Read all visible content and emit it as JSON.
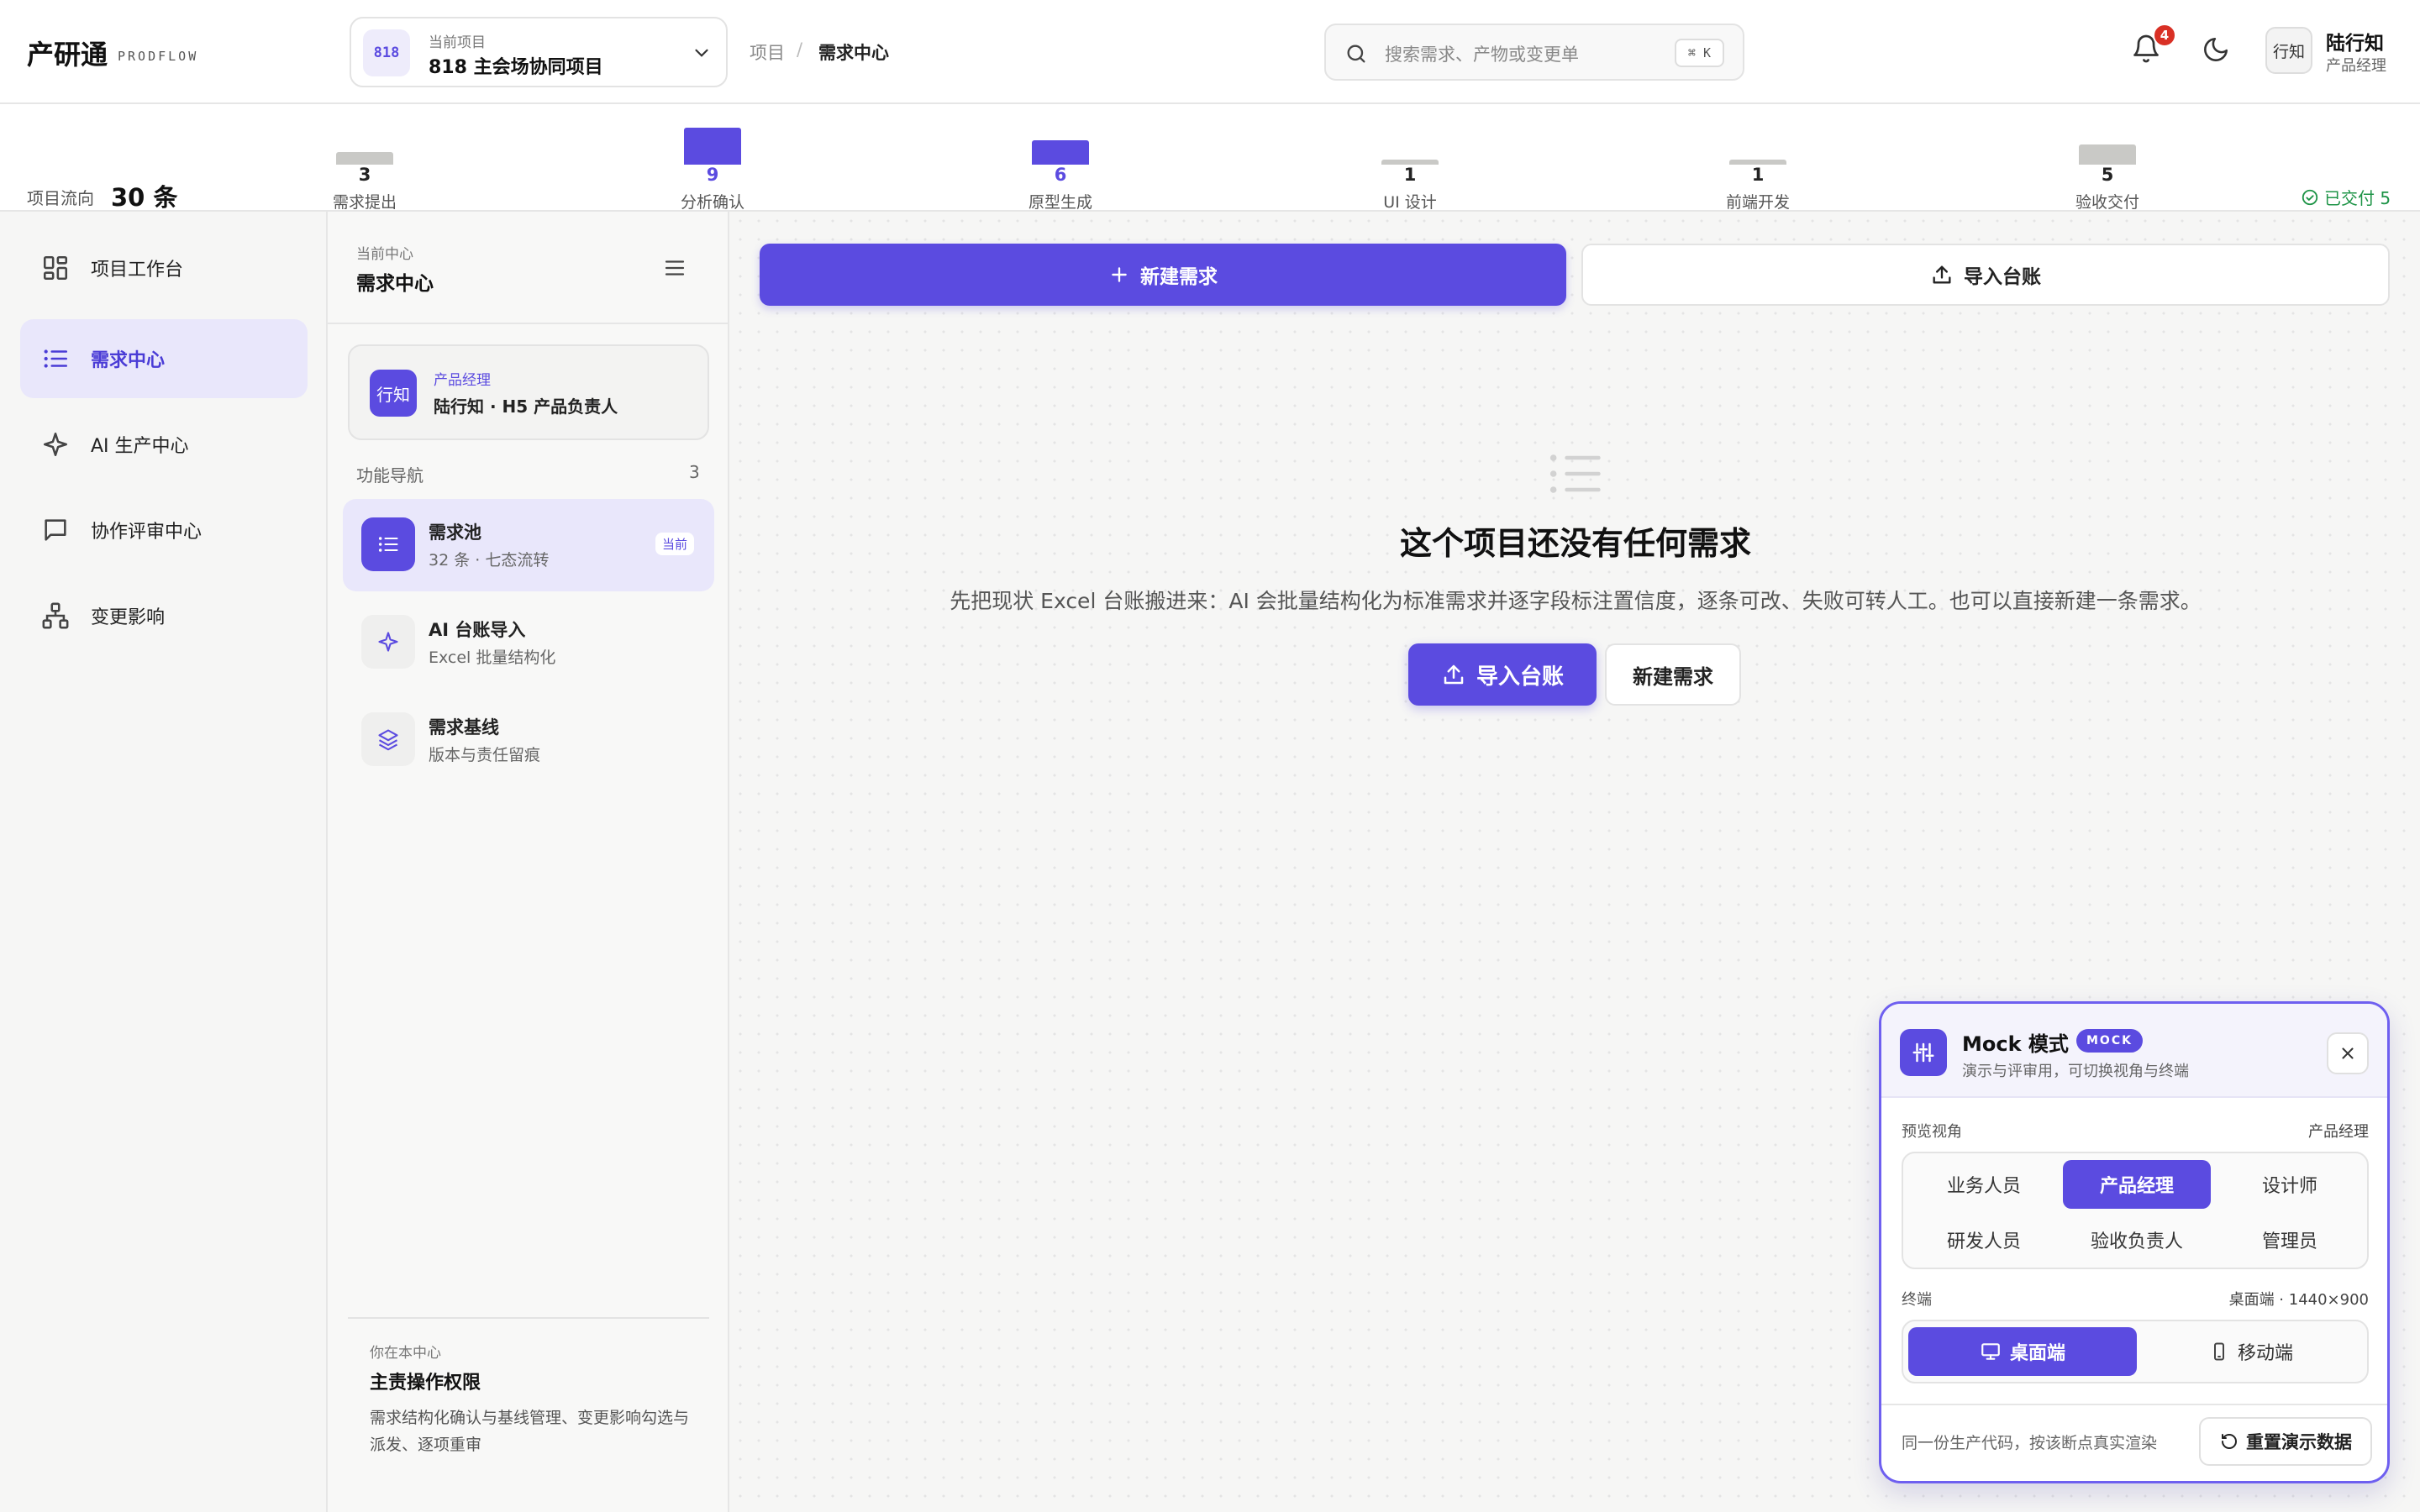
{
  "brand": {
    "name": "产研通",
    "sub": "PRODFLOW"
  },
  "project": {
    "badge": "818",
    "caption": "当前项目",
    "name": "818 主会场协同项目"
  },
  "breadcrumb": {
    "root": "项目",
    "sep": "/",
    "current": "需求中心"
  },
  "search": {
    "placeholder": "搜索需求、产物或变更单",
    "shortcut": "⌘ K"
  },
  "notifications": {
    "count": "4"
  },
  "user": {
    "avatar": "行知",
    "name": "陆行知",
    "role": "产品经理"
  },
  "flow": {
    "title": "项目流向",
    "count": "30 条",
    "stages": [
      {
        "label": "需求提出",
        "count": "3",
        "value": 3,
        "color": "#c9c9c6",
        "numColor": "#222"
      },
      {
        "label": "分析确认",
        "count": "9",
        "value": 9,
        "color": "#5b4be0",
        "numColor": "#5b4be0"
      },
      {
        "label": "原型生成",
        "count": "6",
        "value": 6,
        "color": "#5b4be0",
        "numColor": "#5b4be0"
      },
      {
        "label": "UI 设计",
        "count": "1",
        "value": 1,
        "color": "#c9c9c6",
        "numColor": "#222"
      },
      {
        "label": "前端开发",
        "count": "1",
        "value": 1,
        "color": "#c9c9c6",
        "numColor": "#222"
      },
      {
        "label": "验收交付",
        "count": "5",
        "value": 5,
        "color": "#c9c9c6",
        "numColor": "#222"
      }
    ],
    "delivered": "已交付 5"
  },
  "nav": {
    "items": [
      {
        "label": "项目工作台",
        "icon": "grid-icon"
      },
      {
        "label": "需求中心",
        "icon": "list-icon",
        "active": true
      },
      {
        "label": "AI 生产中心",
        "icon": "sparkle-icon"
      },
      {
        "label": "协作评审中心",
        "icon": "chat-icon"
      },
      {
        "label": "变更影响",
        "icon": "hierarchy-icon"
      }
    ]
  },
  "module": {
    "caption": "当前中心",
    "title": "需求中心",
    "owner": {
      "avatar": "行知",
      "role": "产品经理",
      "name": "陆行知 · H5 产品负责人"
    },
    "fn_head": "功能导航",
    "fn_count": "3",
    "items": [
      {
        "title": "需求池",
        "sub": "32 条 · 七态流转",
        "tag": "当前",
        "icon": "list-icon"
      },
      {
        "title": "AI 台账导入",
        "sub": "Excel 批量结构化",
        "icon": "sparkle-icon"
      },
      {
        "title": "需求基线",
        "sub": "版本与责任留痕",
        "icon": "layers-icon"
      }
    ],
    "perm": {
      "caption": "你在本中心",
      "title": "主责操作权限",
      "desc": "需求结构化确认与基线管理、变更影响勾选与派发、逐项重审"
    }
  },
  "main": {
    "new_btn": "新建需求",
    "import_btn": "导入台账",
    "empty_title": "这个项目还没有任何需求",
    "empty_desc": "先把现状 Excel 台账搬进来：AI 会批量结构化为标准需求并逐字段标注置信度，逐条可改、失败可转人工。也可以直接新建一条需求。",
    "cta_import": "导入台账",
    "cta_new": "新建需求"
  },
  "mock": {
    "title": "Mock 模式",
    "badge": "MOCK",
    "subtitle": "演示与评审用，可切换视角与终端",
    "preview_label": "预览视角",
    "preview_value": "产品经理",
    "roles": [
      "业务人员",
      "产品经理",
      "设计师",
      "研发人员",
      "验收负责人",
      "管理员"
    ],
    "active_role": "产品经理",
    "terminal_label": "终端",
    "terminal_value": "桌面端 · 1440×900",
    "terminals": [
      "桌面端",
      "移动端"
    ],
    "footer": "同一份生产代码，按该断点真实渲染",
    "reset": "重置演示数据"
  },
  "colors": {
    "accent": "#5b4be0",
    "accent_soft": "#e9e7fb",
    "success": "#1e9447",
    "danger": "#d93025"
  }
}
